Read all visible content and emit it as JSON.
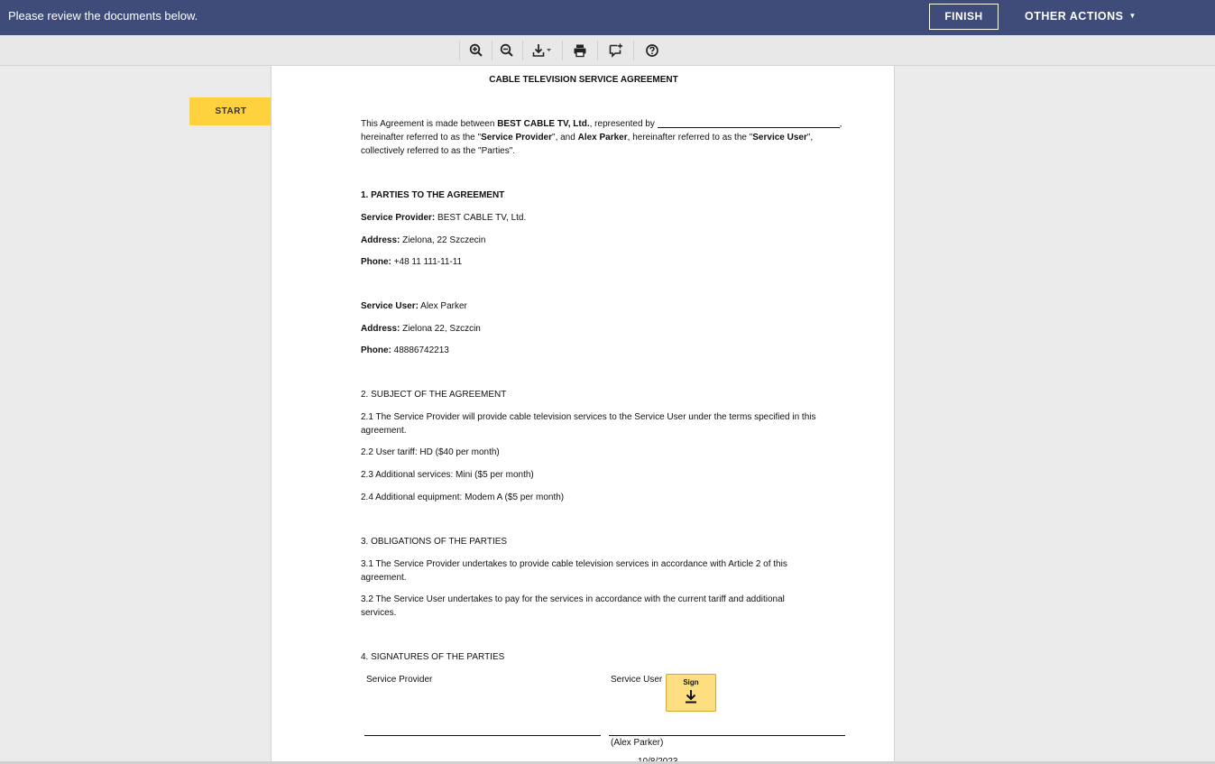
{
  "topbar": {
    "message": "Please review the documents below.",
    "finish_label": "FINISH",
    "other_actions_label": "OTHER ACTIONS",
    "bg_color": "#3f4b79"
  },
  "toolbar": {
    "icons": [
      "zoom-in-icon",
      "zoom-out-icon",
      "download-icon",
      "print-icon",
      "add-comment-icon",
      "help-icon"
    ]
  },
  "start_label": "START",
  "document": {
    "title": "CABLE TELEVISION SERVICE AGREEMENT",
    "intro": {
      "p1": "This Agreement is made between ",
      "provider_bold": "BEST CABLE TV, Ltd.",
      "p2": ", represented by ",
      "comma": ",",
      "p3": "hereinafter referred to as the \"",
      "sp_bold": "Service Provider",
      "p4": "\", and ",
      "user_bold": "Alex Parker",
      "p5": ", hereinafter referred to as the \"",
      "su_bold": "Service User",
      "p6": "\",",
      "p7": "collectively referred to as the \"Parties\"."
    },
    "section1": {
      "heading": "1. PARTIES TO THE AGREEMENT",
      "provider_label": "Service Provider:",
      "provider_value": " BEST CABLE TV, Ltd.",
      "provider_address_label": "Address:",
      "provider_address_value": " Zielona, 22 Szczecin",
      "provider_phone_label": "Phone:",
      "provider_phone_value": " +48 11 111-11-11",
      "user_label": "Service User:",
      "user_value": " Alex Parker",
      "user_address_label": "Address:",
      "user_address_value": " Zielona 22, Szczcin",
      "user_phone_label": "Phone:",
      "user_phone_value": " 48886742213"
    },
    "section2": {
      "heading": "2. SUBJECT OF THE AGREEMENT",
      "p1": "2.1 The Service Provider will provide cable television services to the Service User under the terms specified in this agreement.",
      "p2": "2.2 User tariff: HD ($40 per month)",
      "p3": "2.3 Additional services: Mini ($5 per month)",
      "p4": "2.4 Additional equipment: Modem A ($5 per month)"
    },
    "section3": {
      "heading": "3. OBLIGATIONS OF THE PARTIES",
      "p1": "3.1 The Service Provider undertakes to provide cable television services in accordance with Article 2 of this agreement.",
      "p2": "3.2 The Service User undertakes to pay for the services in accordance with the current tariff and additional services."
    },
    "section4": {
      "heading": "4. SIGNATURES OF THE PARTIES",
      "provider_label": "Service Provider",
      "user_label": "Service User",
      "sign_label": "Sign",
      "user_name": "(Alex Parker)",
      "date_partial": "10/8/2023"
    }
  },
  "colors": {
    "accent_yellow": "#fdd23e",
    "sign_yellow": "#fddf82"
  }
}
